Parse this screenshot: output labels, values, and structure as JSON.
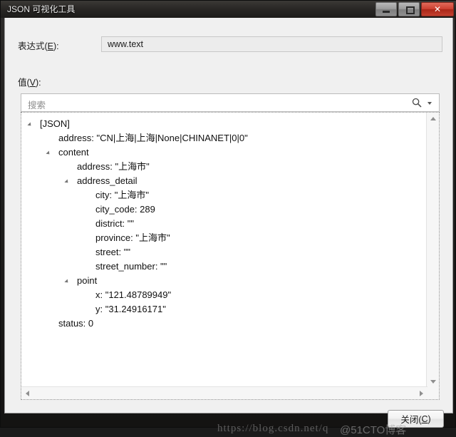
{
  "window": {
    "title": "JSON 可视化工具",
    "caption_buttons": [
      {
        "name": "minimize",
        "glyph": ""
      },
      {
        "name": "maximize",
        "glyph": ""
      },
      {
        "name": "close",
        "glyph": "✕"
      }
    ]
  },
  "form": {
    "expression_label": "表达式(E):",
    "expression_label_prefix": "表达式(",
    "expression_label_mnemonic": "E",
    "expression_label_suffix": "):",
    "expression_value": "www.text",
    "value_label_prefix": "值(",
    "value_label_mnemonic": "V",
    "value_label_suffix": "):"
  },
  "search": {
    "placeholder": "搜索",
    "value": "",
    "icon": "search-icon",
    "dropdown_icon": "chevron-down-icon"
  },
  "tree": {
    "rows": [
      {
        "indent": 0,
        "expander": true,
        "text": "[JSON]"
      },
      {
        "indent": 1,
        "expander": false,
        "text": "address: \"CN|上海|上海|None|CHINANET|0|0\""
      },
      {
        "indent": 1,
        "expander": true,
        "text": "content"
      },
      {
        "indent": 2,
        "expander": false,
        "text": "address: \"上海市\""
      },
      {
        "indent": 2,
        "expander": true,
        "text": "address_detail"
      },
      {
        "indent": 3,
        "expander": false,
        "text": "city: \"上海市\""
      },
      {
        "indent": 3,
        "expander": false,
        "text": "city_code: 289"
      },
      {
        "indent": 3,
        "expander": false,
        "text": "district: \"\""
      },
      {
        "indent": 3,
        "expander": false,
        "text": "province: \"上海市\""
      },
      {
        "indent": 3,
        "expander": false,
        "text": "street: \"\""
      },
      {
        "indent": 3,
        "expander": false,
        "text": "street_number: \"\""
      },
      {
        "indent": 2,
        "expander": true,
        "text": "point"
      },
      {
        "indent": 3,
        "expander": false,
        "text": "x: \"121.48789949\""
      },
      {
        "indent": 3,
        "expander": false,
        "text": "y: \"31.24916171\""
      },
      {
        "indent": 1,
        "expander": false,
        "text": "status: 0"
      }
    ]
  },
  "footer": {
    "close_label": "关闭(C)",
    "close_label_prefix": "关闭(",
    "close_label_mnemonic": "C",
    "close_label_suffix": ")"
  },
  "watermark": {
    "url_text": "https://blog.csdn.net/q",
    "site_text": "@51CTO博客"
  }
}
